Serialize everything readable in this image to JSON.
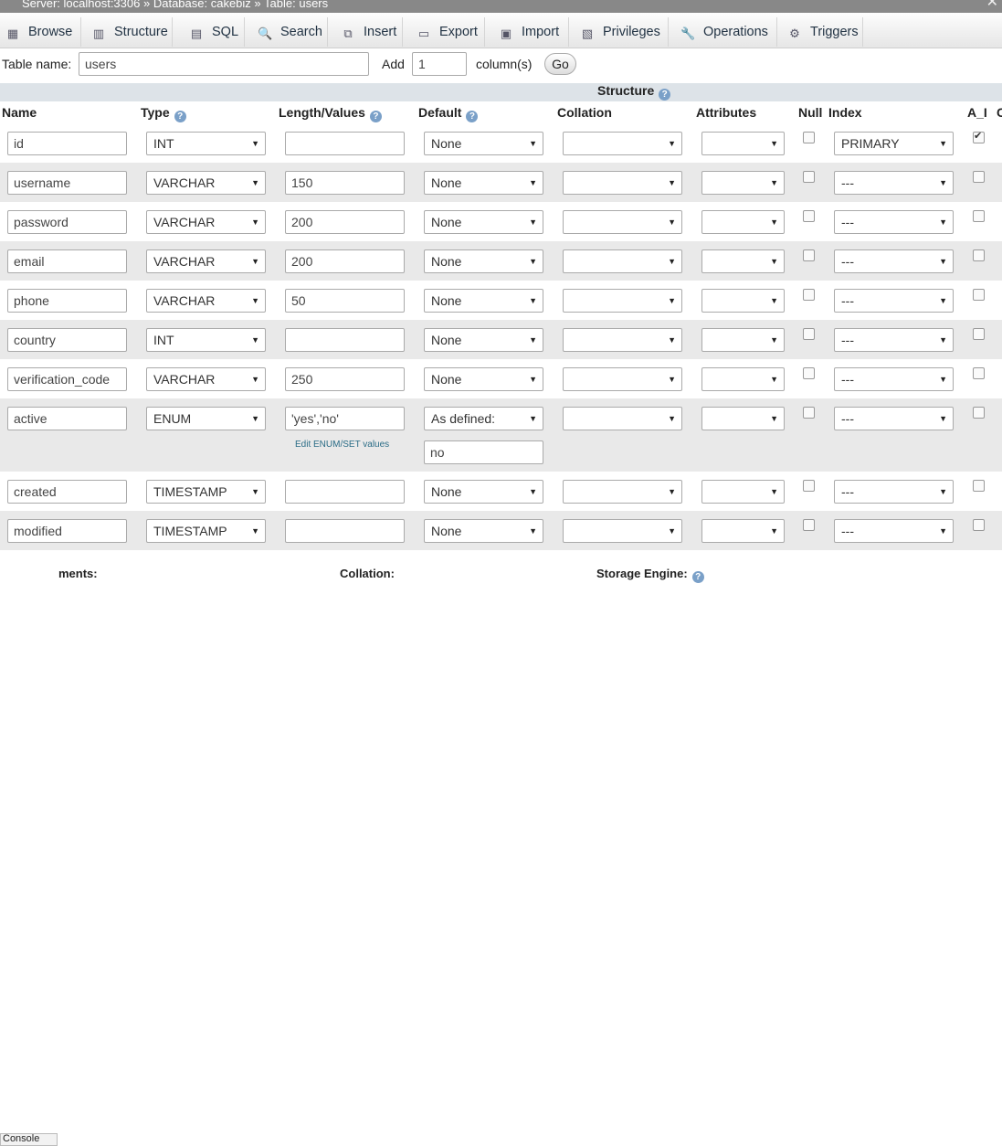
{
  "breadcrumb": {
    "server": "Server: localhost:3306",
    "database": "Database: cakebiz",
    "table": "Table: users",
    "sep": "»"
  },
  "tabs": [
    {
      "label": "Browse",
      "icon": "browse-icon"
    },
    {
      "label": "Structure",
      "icon": "structure-icon"
    },
    {
      "label": "SQL",
      "icon": "sql-icon"
    },
    {
      "label": "Search",
      "icon": "search-icon"
    },
    {
      "label": "Insert",
      "icon": "insert-icon"
    },
    {
      "label": "Export",
      "icon": "export-icon"
    },
    {
      "label": "Import",
      "icon": "import-icon"
    },
    {
      "label": "Privileges",
      "icon": "privileges-icon"
    },
    {
      "label": "Operations",
      "icon": "operations-icon"
    },
    {
      "label": "Triggers",
      "icon": "triggers-icon"
    }
  ],
  "form": {
    "table_name_label": "Table name:",
    "table_name": "users",
    "add_label": "Add",
    "add_count": "1",
    "columns_label": "column(s)",
    "go_label": "Go"
  },
  "structure_title": "Structure",
  "headers": {
    "name": "Name",
    "type": "Type",
    "length": "Length/Values",
    "default": "Default",
    "collation": "Collation",
    "attributes": "Attributes",
    "null": "Null",
    "index": "Index",
    "ai": "A_I",
    "extra": "C"
  },
  "fields": [
    {
      "name": "id",
      "type": "INT",
      "length": "",
      "default": "None",
      "collation": "",
      "attributes": "",
      "null": false,
      "index": "PRIMARY",
      "ai": true
    },
    {
      "name": "username",
      "type": "VARCHAR",
      "length": "150",
      "default": "None",
      "collation": "",
      "attributes": "",
      "null": false,
      "index": "---",
      "ai": false
    },
    {
      "name": "password",
      "type": "VARCHAR",
      "length": "200",
      "default": "None",
      "collation": "",
      "attributes": "",
      "null": false,
      "index": "---",
      "ai": false
    },
    {
      "name": "email",
      "type": "VARCHAR",
      "length": "200",
      "default": "None",
      "collation": "",
      "attributes": "",
      "null": false,
      "index": "---",
      "ai": false
    },
    {
      "name": "phone",
      "type": "VARCHAR",
      "length": "50",
      "default": "None",
      "collation": "",
      "attributes": "",
      "null": false,
      "index": "---",
      "ai": false
    },
    {
      "name": "country",
      "type": "INT",
      "length": "",
      "default": "None",
      "collation": "",
      "attributes": "",
      "null": false,
      "index": "---",
      "ai": false
    },
    {
      "name": "verification_code",
      "type": "VARCHAR",
      "length": "250",
      "default": "None",
      "collation": "",
      "attributes": "",
      "null": false,
      "index": "---",
      "ai": false
    },
    {
      "name": "active",
      "type": "ENUM",
      "length": "'yes','no'",
      "default": "As defined:",
      "default_value": "no",
      "edit_enum": "Edit ENUM/SET values",
      "collation": "",
      "attributes": "",
      "null": false,
      "index": "---",
      "ai": false
    },
    {
      "name": "created",
      "type": "TIMESTAMP",
      "length": "",
      "default": "None",
      "collation": "",
      "attributes": "",
      "null": false,
      "index": "---",
      "ai": false
    },
    {
      "name": "modified",
      "type": "TIMESTAMP",
      "length": "",
      "default": "None",
      "collation": "",
      "attributes": "",
      "null": false,
      "index": "---",
      "ai": false
    }
  ],
  "bottom": {
    "comments_label": "ments:",
    "collation_label": "Collation:",
    "engine_label": "Storage Engine:",
    "console_label": "Console"
  }
}
